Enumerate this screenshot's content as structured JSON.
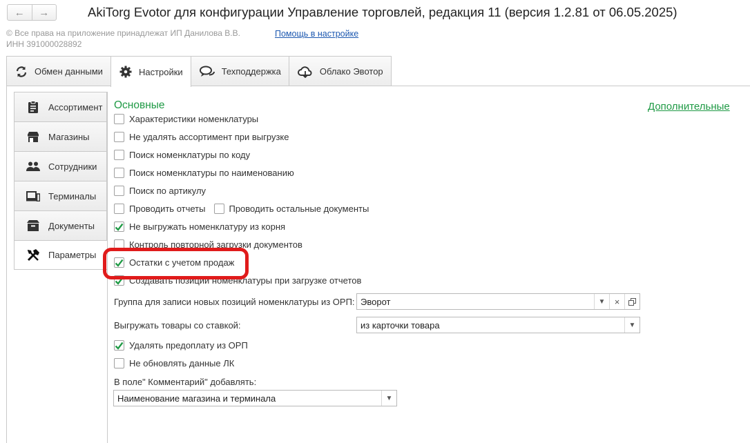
{
  "window": {
    "title": "AkiTorg Evotor для конфигурации Управление торговлей, редакция 11 (версия 1.2.81 от 06.05.2025)",
    "back_icon": "arrow-left-icon",
    "forward_icon": "arrow-right-icon"
  },
  "info": {
    "copyright": "© Все права на приложение принадлежат ИП Данилова В.В.",
    "inn": "ИНН 391000028892",
    "help_link": "Помощь в настройке"
  },
  "tabs": [
    {
      "label": "Обмен данными",
      "icon": "sync-icon"
    },
    {
      "label": "Настройки",
      "icon": "gear-icon",
      "active": true
    },
    {
      "label": "Техподдержка",
      "icon": "chat-icon"
    },
    {
      "label": "Облако Эвотор",
      "icon": "cloud-icon"
    }
  ],
  "sidebar": [
    {
      "label": "Ассортимент",
      "icon": "clipboard-icon"
    },
    {
      "label": "Магазины",
      "icon": "store-icon"
    },
    {
      "label": "Сотрудники",
      "icon": "people-icon"
    },
    {
      "label": "Терминалы",
      "icon": "terminal-icon"
    },
    {
      "label": "Документы",
      "icon": "box-icon"
    },
    {
      "label": "Параметры",
      "icon": "tools-icon",
      "active": true
    }
  ],
  "main": {
    "section_title": "Основные",
    "more_link": "Дополнительные",
    "options": [
      {
        "label": "Характеристики номенклатуры",
        "checked": false
      },
      {
        "label": "Не удалять ассортимент при выгрузке",
        "checked": false
      },
      {
        "label": "Поиск номенклатуры по коду",
        "checked": false
      },
      {
        "label": "Поиск номенклатуры по наименованию",
        "checked": false
      },
      {
        "label": "Поиск по артикулу",
        "checked": false
      },
      {
        "label": "Проводить отчеты",
        "checked": false
      },
      {
        "label": "Проводить остальные документы",
        "checked": false
      },
      {
        "label": "Не выгружать номенклатуру из корня",
        "checked": true
      },
      {
        "label": "Контроль повторной загрузки документов",
        "checked": false
      },
      {
        "label": "Остатки с учетом продаж",
        "checked": true
      },
      {
        "label": "Создавать позиции номенклатуры при загрузке отчетов",
        "checked": true
      },
      {
        "label": "Удалять предоплату из ОРП",
        "checked": true
      },
      {
        "label": "Не обновлять данные ЛК",
        "checked": false
      }
    ],
    "group_field": {
      "label": "Группа для записи новых позиций номенклатуры из ОРП:",
      "value": "Эворот"
    },
    "rate_field": {
      "label": "Выгружать товары со ставкой:",
      "value": "из карточки товара"
    },
    "comment_field": {
      "label": "В поле\" Комментарий\" добавлять:",
      "value": "Наименование магазина и терминала"
    }
  },
  "colors": {
    "accent_green": "#1f9a45",
    "highlight_red": "#e01b1b",
    "link_blue": "#1c58b0"
  }
}
